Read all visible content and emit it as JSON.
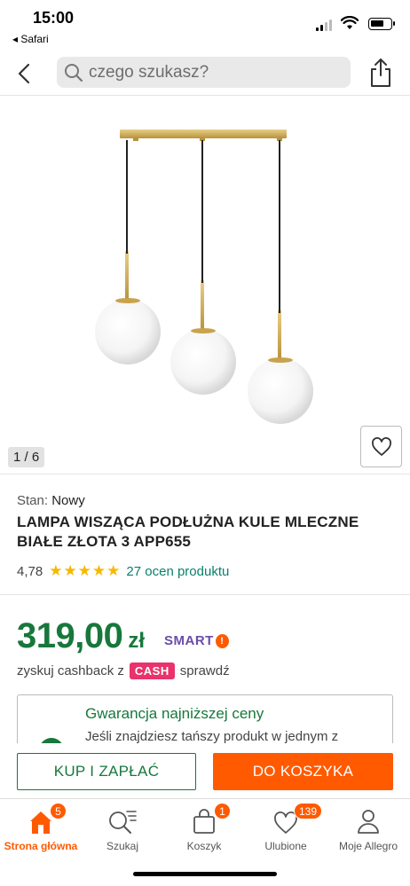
{
  "status_bar": {
    "time": "15:00",
    "back_app": "◂ Safari"
  },
  "header": {
    "search_placeholder": "czego szukasz?"
  },
  "gallery": {
    "counter": "1 / 6"
  },
  "product": {
    "state_label": "Stan:",
    "state_value": "Nowy",
    "title": "LAMPA WISZĄCA PODŁUŻNA KULE MLECZNE BIAŁE ZŁOTA 3 APP655",
    "rating_score": "4,78",
    "rating_stars": "★★★★★",
    "rating_count": "27 ocen produktu",
    "price_main": "319,00",
    "price_currency": "zł",
    "smart_label": "SMART",
    "cashback_prefix": "zyskuj cashback z",
    "cashback_badge": "CASH",
    "cashback_link": "sprawdź"
  },
  "guarantee": {
    "title": "Gwarancja najniższej ceny",
    "text": "Jeśli znajdziesz tańszy produkt w jednym z"
  },
  "actions": {
    "buy_now": "KUP I ZAPŁAĆ",
    "add_to_cart": "DO KOSZYKA"
  },
  "tabbar": {
    "items": [
      {
        "label": "Strona główna",
        "icon": "home-icon",
        "badge": "5"
      },
      {
        "label": "Szukaj",
        "icon": "search-list-icon",
        "badge": ""
      },
      {
        "label": "Koszyk",
        "icon": "bag-icon",
        "badge": "1"
      },
      {
        "label": "Ulubione",
        "icon": "heart-icon",
        "badge": "139"
      },
      {
        "label": "Moje Allegro",
        "icon": "user-icon",
        "badge": ""
      }
    ]
  },
  "colors": {
    "accent": "#ff5a00",
    "price_green": "#16783b",
    "link_teal": "#0a7f6d",
    "star": "#f6b800",
    "cash_pink": "#e8336d",
    "smart_purple": "#6a4da8"
  }
}
